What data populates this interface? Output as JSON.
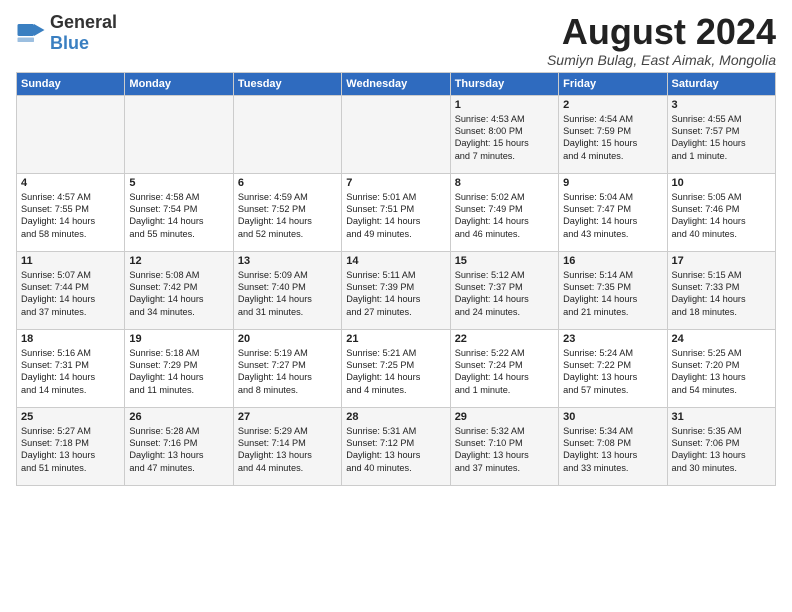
{
  "header": {
    "logo_general": "General",
    "logo_blue": "Blue",
    "title": "August 2024",
    "subtitle": "Sumiyn Bulag, East Aimak, Mongolia"
  },
  "days_of_week": [
    "Sunday",
    "Monday",
    "Tuesday",
    "Wednesday",
    "Thursday",
    "Friday",
    "Saturday"
  ],
  "weeks": [
    [
      {
        "day": "",
        "content": ""
      },
      {
        "day": "",
        "content": ""
      },
      {
        "day": "",
        "content": ""
      },
      {
        "day": "",
        "content": ""
      },
      {
        "day": "1",
        "content": "Sunrise: 4:53 AM\nSunset: 8:00 PM\nDaylight: 15 hours\nand 7 minutes."
      },
      {
        "day": "2",
        "content": "Sunrise: 4:54 AM\nSunset: 7:59 PM\nDaylight: 15 hours\nand 4 minutes."
      },
      {
        "day": "3",
        "content": "Sunrise: 4:55 AM\nSunset: 7:57 PM\nDaylight: 15 hours\nand 1 minute."
      }
    ],
    [
      {
        "day": "4",
        "content": "Sunrise: 4:57 AM\nSunset: 7:55 PM\nDaylight: 14 hours\nand 58 minutes."
      },
      {
        "day": "5",
        "content": "Sunrise: 4:58 AM\nSunset: 7:54 PM\nDaylight: 14 hours\nand 55 minutes."
      },
      {
        "day": "6",
        "content": "Sunrise: 4:59 AM\nSunset: 7:52 PM\nDaylight: 14 hours\nand 52 minutes."
      },
      {
        "day": "7",
        "content": "Sunrise: 5:01 AM\nSunset: 7:51 PM\nDaylight: 14 hours\nand 49 minutes."
      },
      {
        "day": "8",
        "content": "Sunrise: 5:02 AM\nSunset: 7:49 PM\nDaylight: 14 hours\nand 46 minutes."
      },
      {
        "day": "9",
        "content": "Sunrise: 5:04 AM\nSunset: 7:47 PM\nDaylight: 14 hours\nand 43 minutes."
      },
      {
        "day": "10",
        "content": "Sunrise: 5:05 AM\nSunset: 7:46 PM\nDaylight: 14 hours\nand 40 minutes."
      }
    ],
    [
      {
        "day": "11",
        "content": "Sunrise: 5:07 AM\nSunset: 7:44 PM\nDaylight: 14 hours\nand 37 minutes."
      },
      {
        "day": "12",
        "content": "Sunrise: 5:08 AM\nSunset: 7:42 PM\nDaylight: 14 hours\nand 34 minutes."
      },
      {
        "day": "13",
        "content": "Sunrise: 5:09 AM\nSunset: 7:40 PM\nDaylight: 14 hours\nand 31 minutes."
      },
      {
        "day": "14",
        "content": "Sunrise: 5:11 AM\nSunset: 7:39 PM\nDaylight: 14 hours\nand 27 minutes."
      },
      {
        "day": "15",
        "content": "Sunrise: 5:12 AM\nSunset: 7:37 PM\nDaylight: 14 hours\nand 24 minutes."
      },
      {
        "day": "16",
        "content": "Sunrise: 5:14 AM\nSunset: 7:35 PM\nDaylight: 14 hours\nand 21 minutes."
      },
      {
        "day": "17",
        "content": "Sunrise: 5:15 AM\nSunset: 7:33 PM\nDaylight: 14 hours\nand 18 minutes."
      }
    ],
    [
      {
        "day": "18",
        "content": "Sunrise: 5:16 AM\nSunset: 7:31 PM\nDaylight: 14 hours\nand 14 minutes."
      },
      {
        "day": "19",
        "content": "Sunrise: 5:18 AM\nSunset: 7:29 PM\nDaylight: 14 hours\nand 11 minutes."
      },
      {
        "day": "20",
        "content": "Sunrise: 5:19 AM\nSunset: 7:27 PM\nDaylight: 14 hours\nand 8 minutes."
      },
      {
        "day": "21",
        "content": "Sunrise: 5:21 AM\nSunset: 7:25 PM\nDaylight: 14 hours\nand 4 minutes."
      },
      {
        "day": "22",
        "content": "Sunrise: 5:22 AM\nSunset: 7:24 PM\nDaylight: 14 hours\nand 1 minute."
      },
      {
        "day": "23",
        "content": "Sunrise: 5:24 AM\nSunset: 7:22 PM\nDaylight: 13 hours\nand 57 minutes."
      },
      {
        "day": "24",
        "content": "Sunrise: 5:25 AM\nSunset: 7:20 PM\nDaylight: 13 hours\nand 54 minutes."
      }
    ],
    [
      {
        "day": "25",
        "content": "Sunrise: 5:27 AM\nSunset: 7:18 PM\nDaylight: 13 hours\nand 51 minutes."
      },
      {
        "day": "26",
        "content": "Sunrise: 5:28 AM\nSunset: 7:16 PM\nDaylight: 13 hours\nand 47 minutes."
      },
      {
        "day": "27",
        "content": "Sunrise: 5:29 AM\nSunset: 7:14 PM\nDaylight: 13 hours\nand 44 minutes."
      },
      {
        "day": "28",
        "content": "Sunrise: 5:31 AM\nSunset: 7:12 PM\nDaylight: 13 hours\nand 40 minutes."
      },
      {
        "day": "29",
        "content": "Sunrise: 5:32 AM\nSunset: 7:10 PM\nDaylight: 13 hours\nand 37 minutes."
      },
      {
        "day": "30",
        "content": "Sunrise: 5:34 AM\nSunset: 7:08 PM\nDaylight: 13 hours\nand 33 minutes."
      },
      {
        "day": "31",
        "content": "Sunrise: 5:35 AM\nSunset: 7:06 PM\nDaylight: 13 hours\nand 30 minutes."
      }
    ]
  ]
}
